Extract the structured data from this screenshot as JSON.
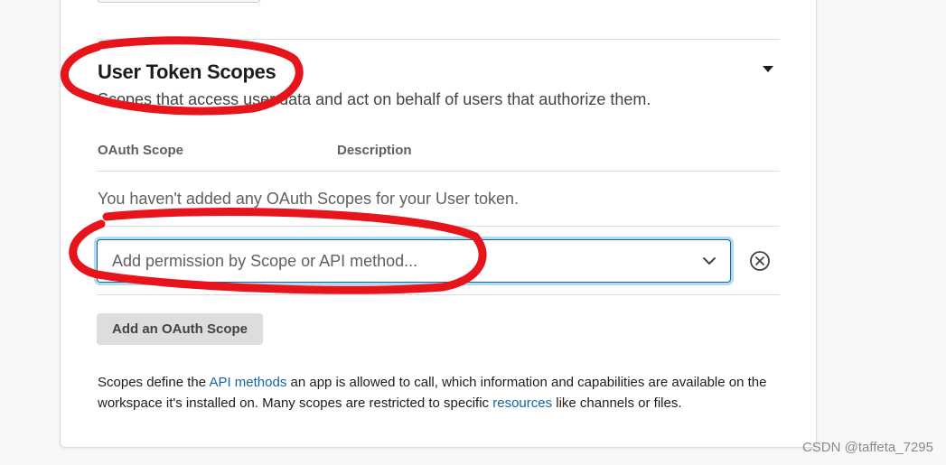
{
  "section": {
    "title": "User Token Scopes",
    "description": "Scopes that access user data and act on behalf of users that authorize them."
  },
  "table": {
    "columns": [
      "OAuth Scope",
      "Description"
    ],
    "empty_message": "You haven't added any OAuth Scopes for your User token."
  },
  "scope_select": {
    "placeholder": "Add permission by Scope or API method..."
  },
  "add_button": {
    "label": "Add an OAuth Scope"
  },
  "help": {
    "part1": "Scopes define the ",
    "link1": "API methods",
    "part2": " an app is allowed to call, which information and capabilities are available on the workspace it's installed on. Many scopes are restricted to specific ",
    "link2": "resources",
    "part3": " like channels or files."
  },
  "watermark": "CSDN @taffeta_7295",
  "colors": {
    "link": "#1264a3",
    "annotation": "#e8141b",
    "focus_ring": "#1d9bd1"
  },
  "icons": {
    "collapse": "caret-down-icon",
    "select": "chevron-down-icon",
    "clear": "circle-x-icon"
  }
}
